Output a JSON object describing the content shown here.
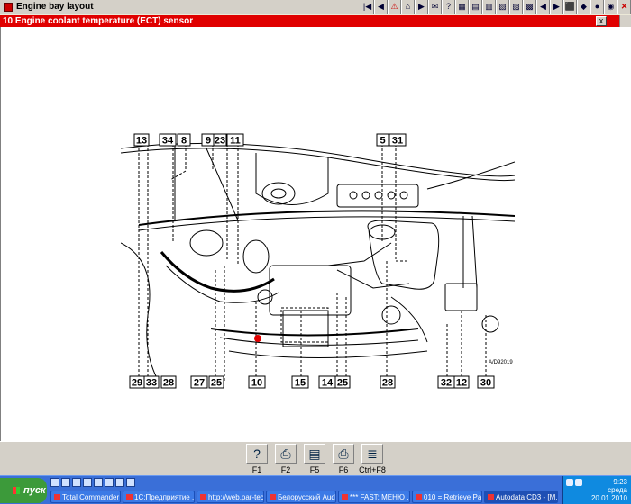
{
  "window": {
    "title": "Engine bay layout"
  },
  "toolbar": [
    "|◀",
    "◀",
    "⚠",
    "⌂",
    "▶",
    "✉",
    "?",
    "▦",
    "▤",
    "▥",
    "▧",
    "▨",
    "▩",
    "◀",
    "▶",
    "⬛",
    "◆",
    "●",
    "◉",
    "✕"
  ],
  "section": {
    "title": "10  Engine coolant temperature (ECT) sensor",
    "close": "x"
  },
  "diagram": {
    "code": "A/D92019",
    "labels_top": [
      "13",
      "34",
      "8",
      "9",
      "23",
      "11",
      "5",
      "31"
    ],
    "labels_bottom": [
      "29",
      "33",
      "28",
      "27",
      "25",
      "10",
      "15",
      "14",
      "25",
      "28",
      "32",
      "12",
      "30"
    ]
  },
  "fkeys": [
    {
      "key": "F1",
      "icon": "help-icon"
    },
    {
      "key": "F2",
      "icon": "printer-icon"
    },
    {
      "key": "F5",
      "icon": "page-icon"
    },
    {
      "key": "F6",
      "icon": "print-preview-icon"
    },
    {
      "key": "Ctrl+F8",
      "icon": "list-icon"
    }
  ],
  "taskbar": {
    "start": "пуск",
    "tasks": [
      "Total Commander ...",
      "1С:Предприятие ...",
      "http://web.par-tec...",
      "Белорусский Audi ...",
      "*** FAST: МЕНЮ ...",
      "010 = Retrieve Pa...",
      "Autodata CD3 - [M..."
    ],
    "time": "9:23",
    "day": "среда",
    "date": "20.01.2010"
  }
}
